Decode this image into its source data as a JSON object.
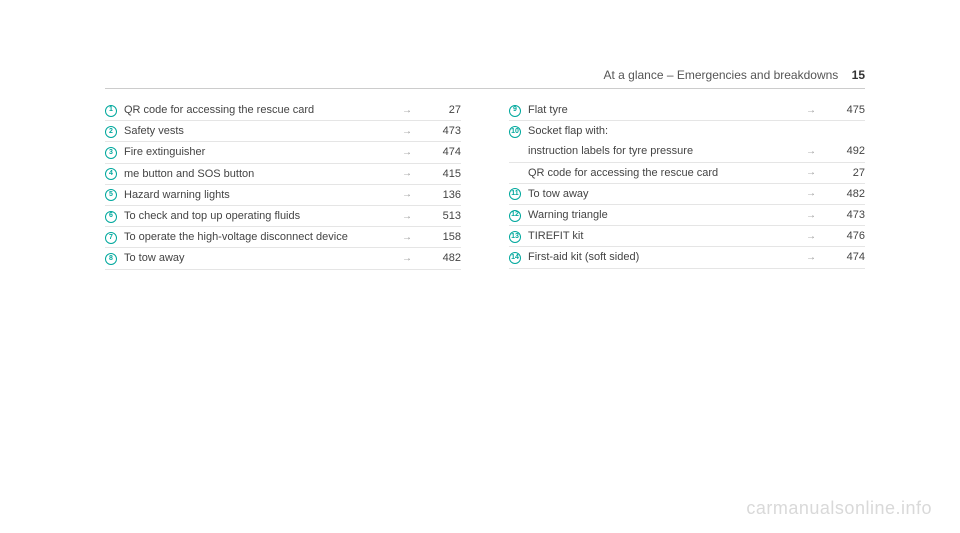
{
  "header": {
    "title": "At a glance – Emergencies and breakdowns",
    "page_number": "15"
  },
  "arrow_glyph": "→",
  "left_column": [
    {
      "n": "1",
      "label": "QR code for accessing the rescue card",
      "page": "27"
    },
    {
      "n": "2",
      "label": "Safety vests",
      "page": "473"
    },
    {
      "n": "3",
      "label": "Fire extinguisher",
      "page": "474"
    },
    {
      "n": "4",
      "label": "me button and SOS button",
      "page": "415"
    },
    {
      "n": "5",
      "label": "Hazard warning lights",
      "page": "136"
    },
    {
      "n": "6",
      "label": "To check and top up operating fluids",
      "page": "513"
    },
    {
      "n": "7",
      "label": "To operate the high-voltage disconnect device",
      "page": "158"
    },
    {
      "n": "8",
      "label": "To tow away",
      "page": "482"
    }
  ],
  "right_column": [
    {
      "n": "9",
      "label": "Flat tyre",
      "page": "475"
    },
    {
      "n": "10",
      "label": "Socket flap with:",
      "page": ""
    },
    {
      "n": "",
      "label": "instruction labels for tyre pressure",
      "page": "492"
    },
    {
      "n": "",
      "label": "QR code for accessing the rescue card",
      "page": "27"
    },
    {
      "n": "11",
      "label": "To tow away",
      "page": "482"
    },
    {
      "n": "12",
      "label": "Warning triangle",
      "page": "473"
    },
    {
      "n": "13",
      "label": "TIREFIT kit",
      "page": "476"
    },
    {
      "n": "14",
      "label": "First-aid kit (soft sided)",
      "page": "474"
    }
  ],
  "watermark": "carmanualsonline.info"
}
